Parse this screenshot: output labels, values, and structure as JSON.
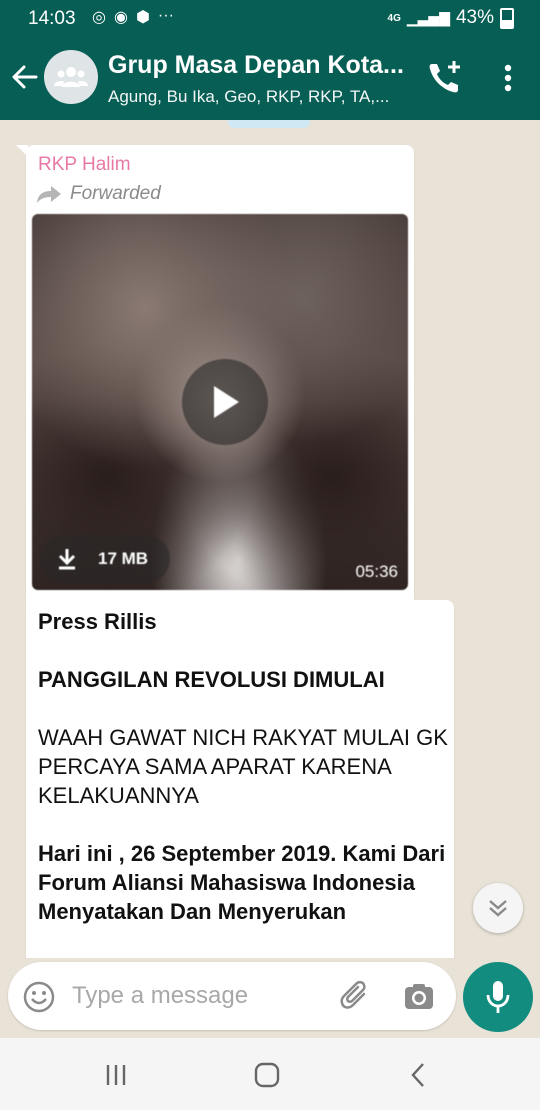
{
  "status_bar": {
    "time": "14:03",
    "network": "4G",
    "battery": "43%"
  },
  "header": {
    "title": "Grup Masa Depan Kota...",
    "subtitle": "Agung, Bu Ika, Geo, RKP, RKP, TA,..."
  },
  "messages": {
    "video": {
      "sender": "RKP Halim",
      "forwarded_label": "Forwarded",
      "size": "17 MB",
      "duration": "05:36"
    },
    "text": {
      "line1": "Press Rillis",
      "line2": "PANGGILAN REVOLUSI DIMULAI",
      "line3": "WAAH GAWAT NICH RAKYAT MULAI GK PERCAYA SAMA APARAT KARENA KELAKUANNYA",
      "line4": "Hari ini , 26 September 2019. Kami Dari Forum Aliansi Mahasiswa Indonesia Menyatakan Dan Menyerukan"
    }
  },
  "composer": {
    "placeholder": "Type a message"
  },
  "colors": {
    "header": "#075e54",
    "accent": "#128c7e",
    "sender": "#e879a6",
    "chat_bg": "#e9e2d6"
  }
}
